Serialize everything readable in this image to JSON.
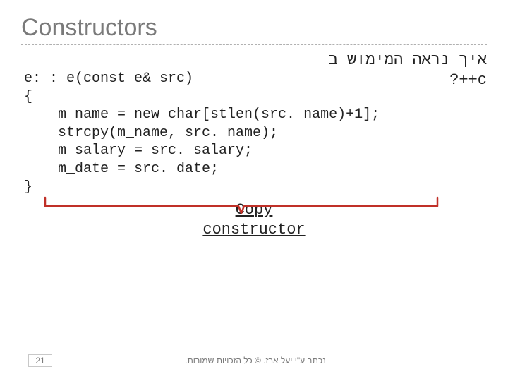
{
  "title": "Constructors",
  "hebrew_line1": "איך נראה המימוש ב",
  "hebrew_line2": "c++?",
  "code_lines": [
    "e: : e(const e& src)",
    "{",
    "    m_name = new char[stlen(src. name)+1];",
    "    strcpy(m_name, src. name);",
    "    m_salary = src. salary;",
    "    m_date = src. date;",
    "}"
  ],
  "label_line1": "Copy",
  "label_line2": "constructor",
  "footer_credit": "נכתב ע\"י יעל ארז. © כל הזכויות שמורות.",
  "page_number": "21"
}
